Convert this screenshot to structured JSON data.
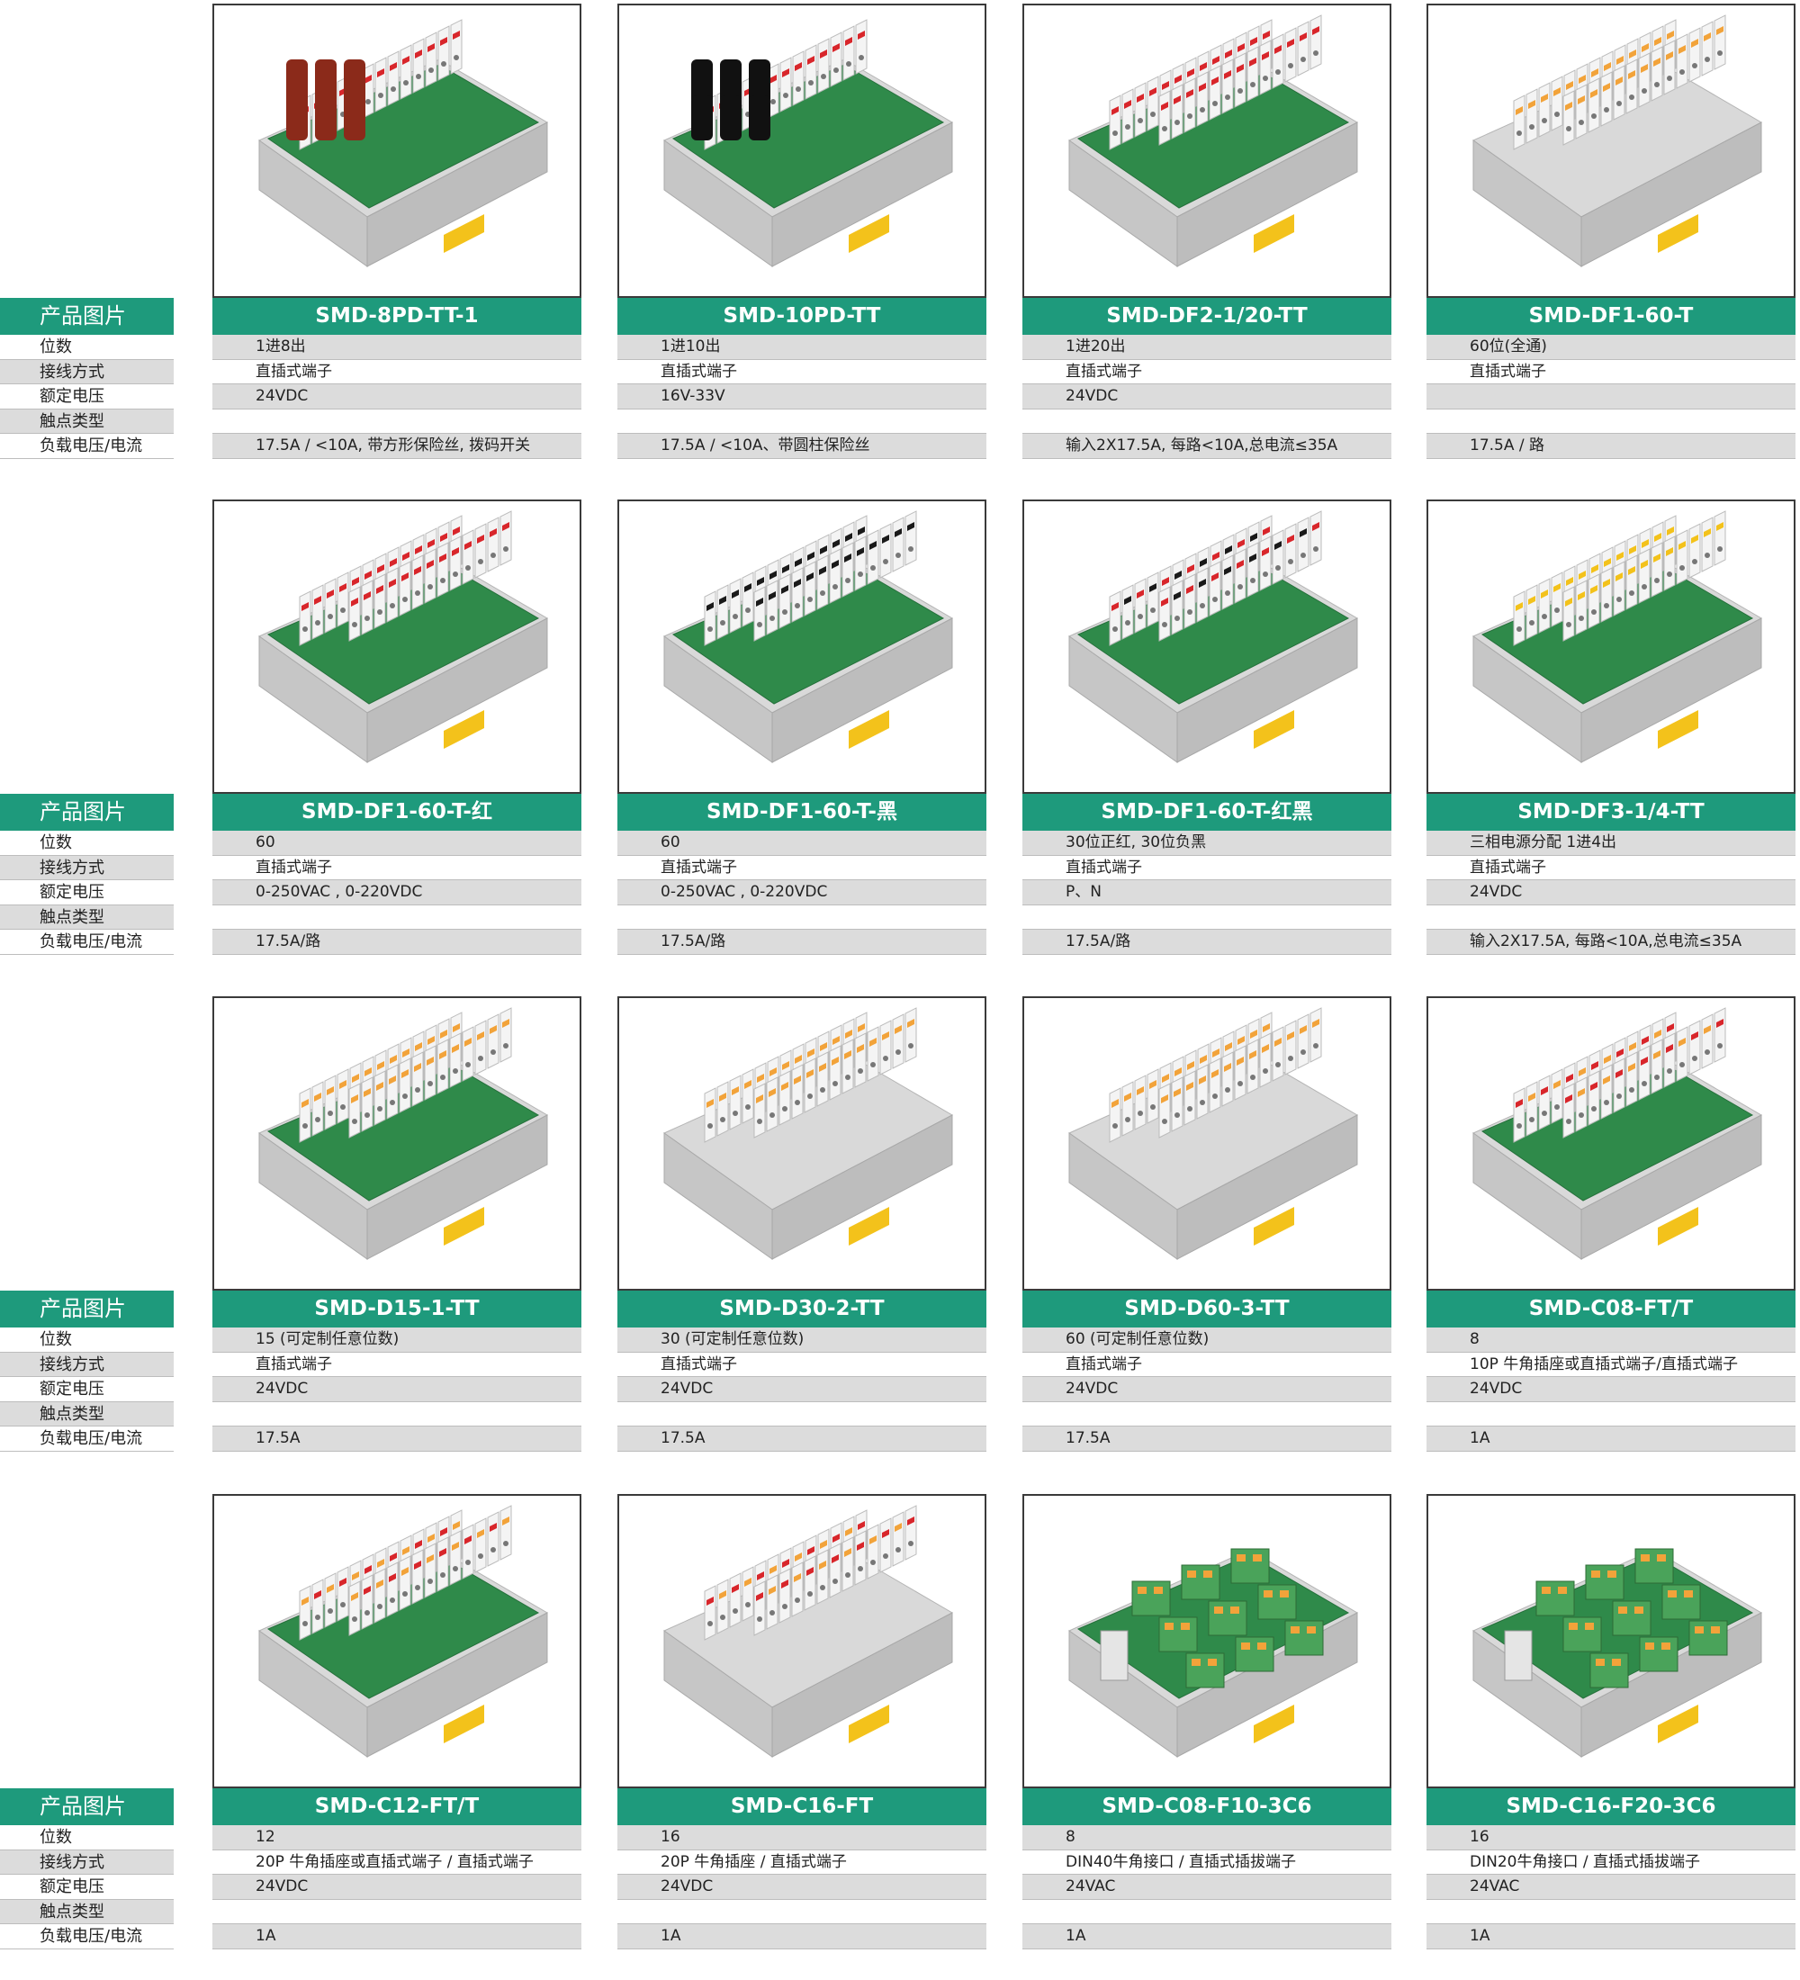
{
  "labels": {
    "header": "产品图片",
    "rows": [
      "位数",
      "接线方式",
      "额定电压",
      "触点类型",
      "负载电压/电流"
    ]
  },
  "groups": [
    {
      "products": [
        {
          "model": "SMD-8PD-TT-1",
          "specs": [
            "1进8出",
            "直插式端子",
            "24VDC",
            "",
            "17.5A  / <10A, 带方形保险丝, 拨码开关"
          ]
        },
        {
          "model": "SMD-10PD-TT",
          "specs": [
            "1进10出",
            "直插式端子",
            "16V-33V",
            "",
            "17.5A  /  <10A、带圆柱保险丝"
          ]
        },
        {
          "model": "SMD-DF2-1/20-TT",
          "specs": [
            "1进20出",
            "直插式端子",
            "24VDC",
            "",
            "输入2X17.5A, 每路<10A,总电流≤35A"
          ]
        },
        {
          "model": "SMD-DF1-60-T",
          "specs": [
            "60位(全通)",
            "直插式端子",
            "",
            "",
            "17.5A  /  路"
          ]
        }
      ]
    },
    {
      "products": [
        {
          "model": "SMD-DF1-60-T-红",
          "specs": [
            "60",
            "直插式端子",
            "0-250VAC , 0-220VDC",
            "",
            "17.5A/路"
          ]
        },
        {
          "model": "SMD-DF1-60-T-黑",
          "specs": [
            "60",
            "直插式端子",
            "0-250VAC , 0-220VDC",
            "",
            "17.5A/路"
          ]
        },
        {
          "model": "SMD-DF1-60-T-红黑",
          "specs": [
            "30位正红, 30位负黑",
            "直插式端子",
            "P、N",
            "",
            "17.5A/路"
          ]
        },
        {
          "model": "SMD-DF3-1/4-TT",
          "specs": [
            "三相电源分配 1进4出",
            "直插式端子",
            "24VDC",
            "",
            "输入2X17.5A, 每路<10A,总电流≤35A"
          ]
        }
      ]
    },
    {
      "products": [
        {
          "model": "SMD-D15-1-TT",
          "specs": [
            "15 (可定制任意位数)",
            "直插式端子",
            "24VDC",
            "",
            "17.5A"
          ]
        },
        {
          "model": "SMD-D30-2-TT",
          "specs": [
            "30 (可定制任意位数)",
            "直插式端子",
            "24VDC",
            "",
            "17.5A"
          ]
        },
        {
          "model": "SMD-D60-3-TT",
          "specs": [
            "60 (可定制任意位数)",
            "直插式端子",
            "24VDC",
            "",
            "17.5A"
          ]
        },
        {
          "model": "SMD-C08-FT/T",
          "specs": [
            "8",
            "10P 牛角插座或直插式端子/直插式端子",
            "24VDC",
            "",
            "1A"
          ]
        }
      ]
    },
    {
      "products": [
        {
          "model": "SMD-C12-FT/T",
          "specs": [
            "12",
            "20P 牛角插座或直插式端子  /  直插式端子",
            "24VDC",
            "",
            "1A"
          ]
        },
        {
          "model": "SMD-C16-FT",
          "specs": [
            "16",
            "20P 牛角插座  /  直插式端子",
            "24VDC",
            "",
            "1A"
          ]
        },
        {
          "model": "SMD-C08-F10-3C6",
          "specs": [
            "8",
            "DIN40牛角接口  /  直插式插拔端子",
            "24VAC",
            "",
            "1A"
          ]
        },
        {
          "model": "SMD-C16-F20-3C6",
          "specs": [
            "16",
            "DIN20牛角接口  /  直插式插拔端子",
            "24VAC",
            "",
            "1A"
          ]
        }
      ]
    }
  ],
  "colors": {
    "header_green": "#1e9a7c",
    "row_gray": "#dcdcdc",
    "pcb_green": "#2f8a4a",
    "housing_gray": "#d8d8d8",
    "terminal_white": "#f4f4f4",
    "accent_orange": "#f2a33a",
    "accent_red": "#d8262b",
    "accent_black": "#1a1a1a",
    "rail_yellow": "#f3c21b"
  }
}
